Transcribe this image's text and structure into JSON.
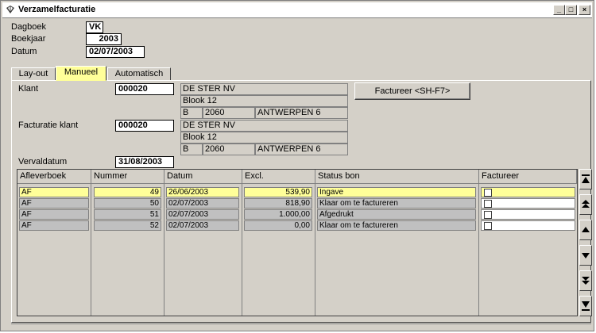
{
  "window": {
    "title": "Verzamelfacturatie",
    "controls": {
      "minimize": "_",
      "maximize": "□",
      "close": "×"
    }
  },
  "header": {
    "dagboek_label": "Dagboek",
    "dagboek_value": "VK",
    "boekjaar_label": "Boekjaar",
    "boekjaar_value": "2003",
    "datum_label": "Datum",
    "datum_value": "02/07/2003"
  },
  "tabs": [
    {
      "label": "Lay-out",
      "active": false
    },
    {
      "label": "Manueel",
      "active": true
    },
    {
      "label": "Automatisch",
      "active": false
    }
  ],
  "klant": {
    "label": "Klant",
    "number": "000020",
    "name": "DE STER NV",
    "street": "Blook 12",
    "country": "B",
    "zip": "2060",
    "city": "ANTWERPEN 6"
  },
  "facturatie_klant": {
    "label": "Facturatie klant",
    "number": "000020",
    "name": "DE STER NV",
    "street": "Blook 12",
    "country": "B",
    "zip": "2060",
    "city": "ANTWERPEN 6"
  },
  "vervaldatum": {
    "label": "Vervaldatum",
    "value": "31/08/2003"
  },
  "factureer_button": "Factureer <SH-F7>",
  "table": {
    "columns": [
      "Afleverboek",
      "Nummer",
      "Datum",
      "Excl.",
      "Status bon",
      "Factureer"
    ],
    "rows": [
      {
        "afleverboek": "AF",
        "nummer": "49",
        "datum": "26/06/2003",
        "excl": "539,90",
        "status": "Ingave",
        "factureer": false,
        "selected": true
      },
      {
        "afleverboek": "AF",
        "nummer": "50",
        "datum": "02/07/2003",
        "excl": "818,90",
        "status": "Klaar om te factureren",
        "factureer": false,
        "selected": false
      },
      {
        "afleverboek": "AF",
        "nummer": "51",
        "datum": "02/07/2003",
        "excl": "1.000,00",
        "status": "Afgedrukt",
        "factureer": false,
        "selected": false
      },
      {
        "afleverboek": "AF",
        "nummer": "52",
        "datum": "02/07/2003",
        "excl": "0,00",
        "status": "Klaar om te factureren",
        "factureer": false,
        "selected": false
      }
    ]
  },
  "colors": {
    "highlight": "#ffff99",
    "face": "#d4d0c8"
  }
}
